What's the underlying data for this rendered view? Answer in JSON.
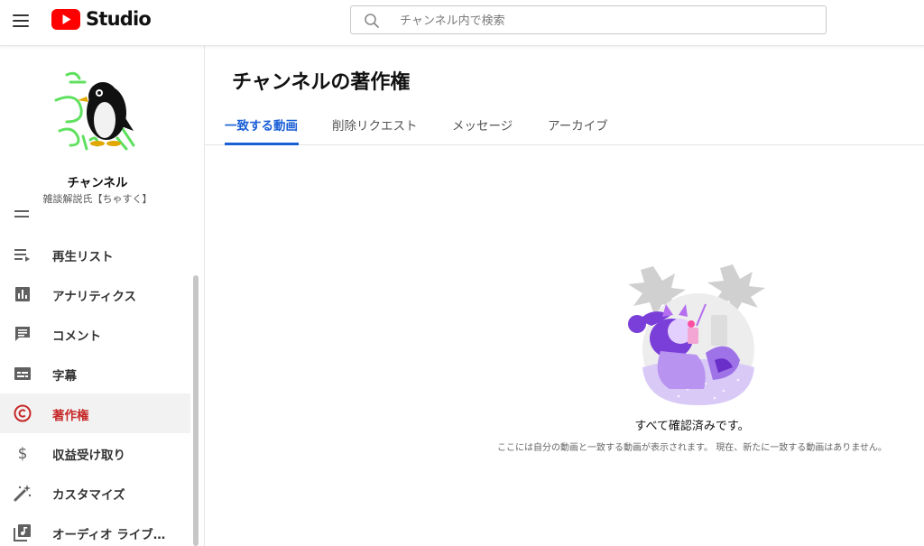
{
  "header": {
    "logo_text": "Studio",
    "search_placeholder": "チャンネル内で検索"
  },
  "channel": {
    "title": "チャンネル",
    "subtitle": "雑談解説氏【ちゃすく】"
  },
  "sidebar": {
    "items": [
      {
        "label": "再生リスト",
        "icon": "playlist-icon"
      },
      {
        "label": "アナリティクス",
        "icon": "analytics-icon"
      },
      {
        "label": "コメント",
        "icon": "comment-icon"
      },
      {
        "label": "字幕",
        "icon": "subtitles-icon"
      },
      {
        "label": "著作権",
        "icon": "copyright-icon",
        "active": true
      },
      {
        "label": "収益受け取り",
        "icon": "dollar-icon"
      },
      {
        "label": "カスタマイズ",
        "icon": "magic-wand-icon"
      },
      {
        "label": "オーディオ ライブ…",
        "icon": "audio-library-icon"
      }
    ]
  },
  "main": {
    "title": "チャンネルの著作権",
    "tabs": [
      {
        "label": "一致する動画",
        "active": true
      },
      {
        "label": "削除リクエスト"
      },
      {
        "label": "メッセージ"
      },
      {
        "label": "アーカイブ"
      }
    ],
    "empty_state": {
      "title": "すべて確認済みです。",
      "description": "ここには自分の動画と一致する動画が表示されます。 現在、新たに一致する動画はありません。"
    }
  },
  "colors": {
    "accent": "#1a5fd6",
    "active_nav": "#c62828",
    "brand_red": "#ff0000",
    "illustration_purple": "#7b3fd9"
  }
}
